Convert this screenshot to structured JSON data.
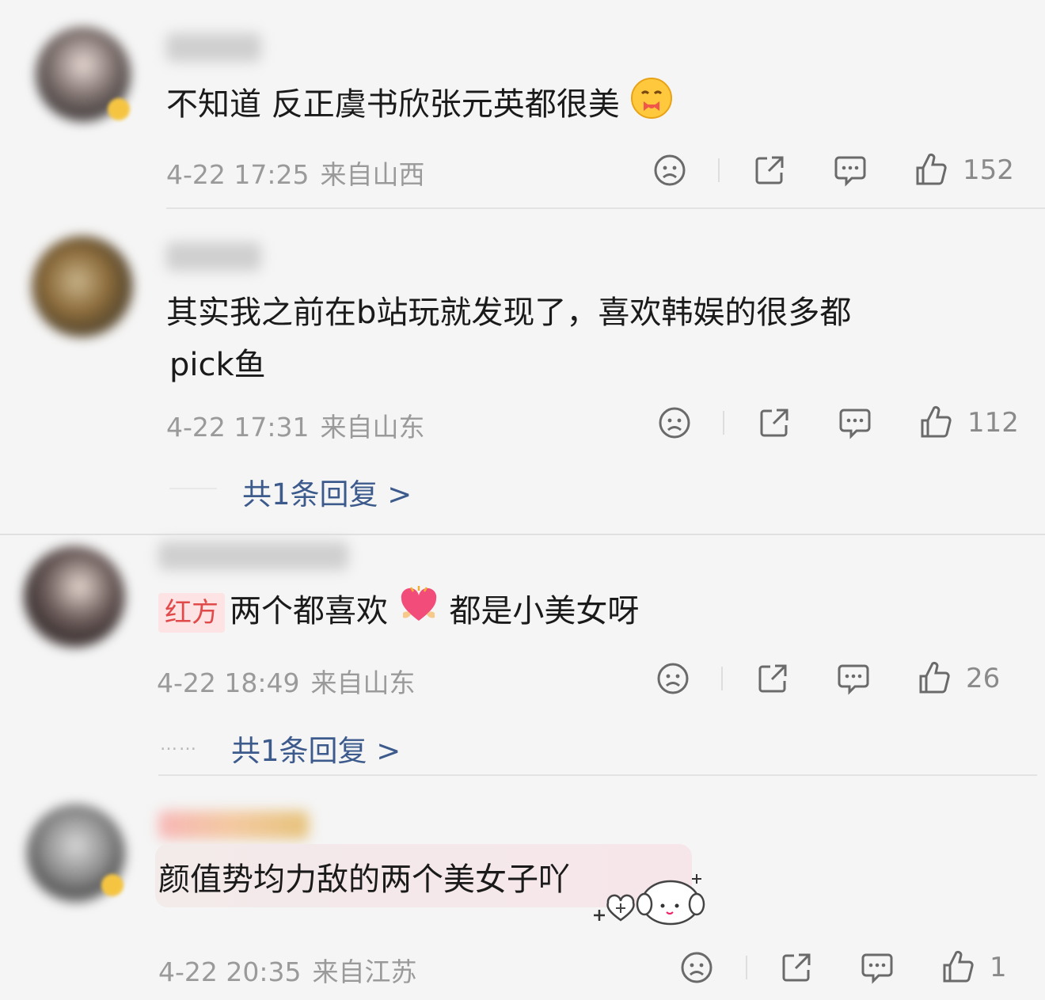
{
  "comments": [
    {
      "text": "不知道 反正虞书欣张元英都很美",
      "time": "4-22 17:25",
      "location": "来自山西",
      "likes": "152",
      "reply_link": ""
    },
    {
      "text_line1": "其实我之前在b站玩就发现了，喜欢韩娱的很多都",
      "text_line2": "pick鱼",
      "time": "4-22 17:31",
      "location": "来自山东",
      "likes": "112",
      "reply_link": "共1条回复 >"
    },
    {
      "tag": "红方",
      "text_before": "两个都喜欢",
      "text_after": "都是小美女呀",
      "time": "4-22 18:49",
      "location": "来自山东",
      "likes": "26",
      "reply_link": "共1条回复 >",
      "reply_dots": "……"
    },
    {
      "text": "颜值势均力敌的两个美女子吖",
      "time": "4-22 20:35",
      "location": "来自江苏",
      "likes": "1"
    }
  ],
  "icons": [
    "dislike-icon",
    "share-icon",
    "comment-icon",
    "like-icon",
    "hug-emoji",
    "heart-emoji",
    "sticker-icon"
  ],
  "colors": {
    "reply_link": "#3c5a8c",
    "meta": "#9a9a9a",
    "tag_bg": "#fde3e3",
    "tag_text": "#e04a4a"
  }
}
